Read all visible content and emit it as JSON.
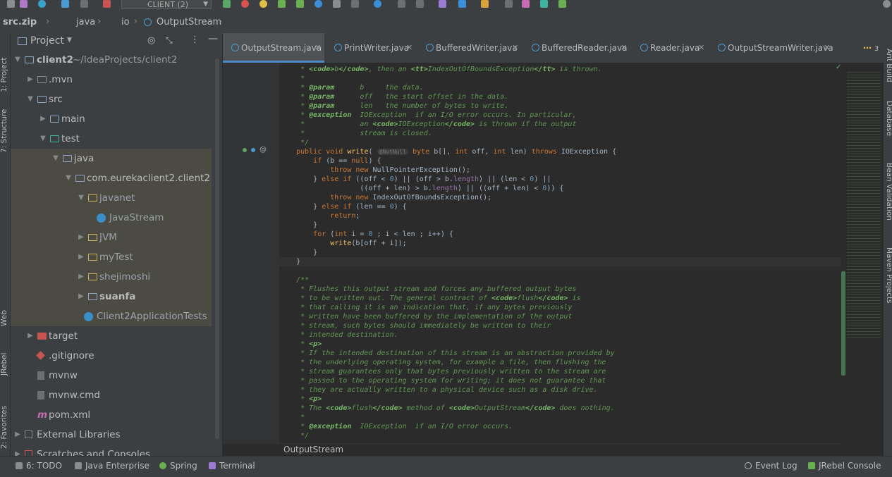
{
  "toolbar": {
    "run_config": "CLIENT (2)"
  },
  "navbar": {
    "crumbs": [
      "src.zip",
      "java",
      "io",
      "OutputStream"
    ]
  },
  "left_strip": {
    "project": "1: Project",
    "structure": "7: Structure",
    "web": "Web",
    "jrebel": "JRebel",
    "favorites": "2: Favorites"
  },
  "project_panel": {
    "title": "Project",
    "tree": [
      {
        "label": "client2",
        "extra": "~/IdeaProjects/client2"
      },
      {
        "label": ".mvn"
      },
      {
        "label": "src"
      },
      {
        "label": "main"
      },
      {
        "label": "test"
      },
      {
        "label": "java"
      },
      {
        "label": "com.eurekaclient2.client2"
      },
      {
        "label": "javanet"
      },
      {
        "label": "JavaStream"
      },
      {
        "label": "JVM"
      },
      {
        "label": "myTest"
      },
      {
        "label": "shejimoshi"
      },
      {
        "label": "suanfa"
      },
      {
        "label": "Client2ApplicationTests"
      },
      {
        "label": "target"
      },
      {
        "label": ".gitignore"
      },
      {
        "label": "mvnw"
      },
      {
        "label": "mvnw.cmd"
      },
      {
        "label": "pom.xml"
      },
      {
        "label": "External Libraries"
      },
      {
        "label": "Scratches and Consoles"
      }
    ]
  },
  "tabs": [
    {
      "label": "OutputStream.java"
    },
    {
      "label": "PrintWriter.java"
    },
    {
      "label": "BufferedWriter.java"
    },
    {
      "label": "BufferedReader.java"
    },
    {
      "label": "Reader.java"
    },
    {
      "label": "OutputStreamWriter.java"
    }
  ],
  "tabs_overflow": "3",
  "right_strip": {
    "ant": "Ant Build",
    "database": "Database",
    "bean": "Bean Validation",
    "maven": "Maven Projects"
  },
  "editor": {
    "lines": [
      "     * <code>b</code>, then an <tt>IndexOutOfBoundsException</tt> is thrown.",
      "     *",
      "     * @param      b     the data.",
      "     * @param      off   the start offset in the data.",
      "     * @param      len   the number of bytes to write.",
      "     * @exception  IOException  if an I/O error occurs. In particular,",
      "     *             an <code>IOException</code> is thrown if the output",
      "     *             stream is closed.",
      "     */",
      "    public void write( @NotNull byte b[], int off, int len) throws IOException {",
      "        if (b == null) {",
      "            throw new NullPointerException();",
      "        } else if ((off < 0) || (off > b.length) || (len < 0) ||",
      "                   ((off + len) > b.length) || ((off + len) < 0)) {",
      "            throw new IndexOutOfBoundsException();",
      "        } else if (len == 0) {",
      "            return;",
      "        }",
      "        for (int i = 0 ; i < len ; i++) {",
      "            write(b[off + i]);",
      "        }",
      "    }",
      "",
      "    /**",
      "     * Flushes this output stream and forces any buffered output bytes",
      "     * to be written out. The general contract of <code>flush</code> is",
      "     * that calling it is an indication that, if any bytes previously",
      "     * written have been buffered by the implementation of the output",
      "     * stream, such bytes should immediately be written to their",
      "     * intended destination.",
      "     * <p>",
      "     * If the intended destination of this stream is an abstraction provided by",
      "     * the underlying operating system, for example a file, then flushing the",
      "     * stream guarantees only that bytes previously written to the stream are",
      "     * passed to the operating system for writing; it does not guarantee that",
      "     * they are actually written to a physical device such as a disk drive.",
      "     * <p>",
      "     * The <code>flush</code> method of <code>OutputStream</code> does nothing.",
      "     *",
      "     * @exception  IOException  if an I/O error occurs.",
      "     */"
    ],
    "footer_crumb": "OutputStream"
  },
  "bottombar": {
    "todo": "6: TODO",
    "java_enterprise": "Java Enterprise",
    "spring": "Spring",
    "terminal": "Terminal",
    "event_log": "Event Log",
    "jrebel_console": "JRebel Console"
  },
  "colors": {
    "accent": "#4a88c7",
    "background": "#2b2b2b",
    "panel": "#3c3f41",
    "javadoc": "#629755",
    "keyword": "#cc7832"
  }
}
